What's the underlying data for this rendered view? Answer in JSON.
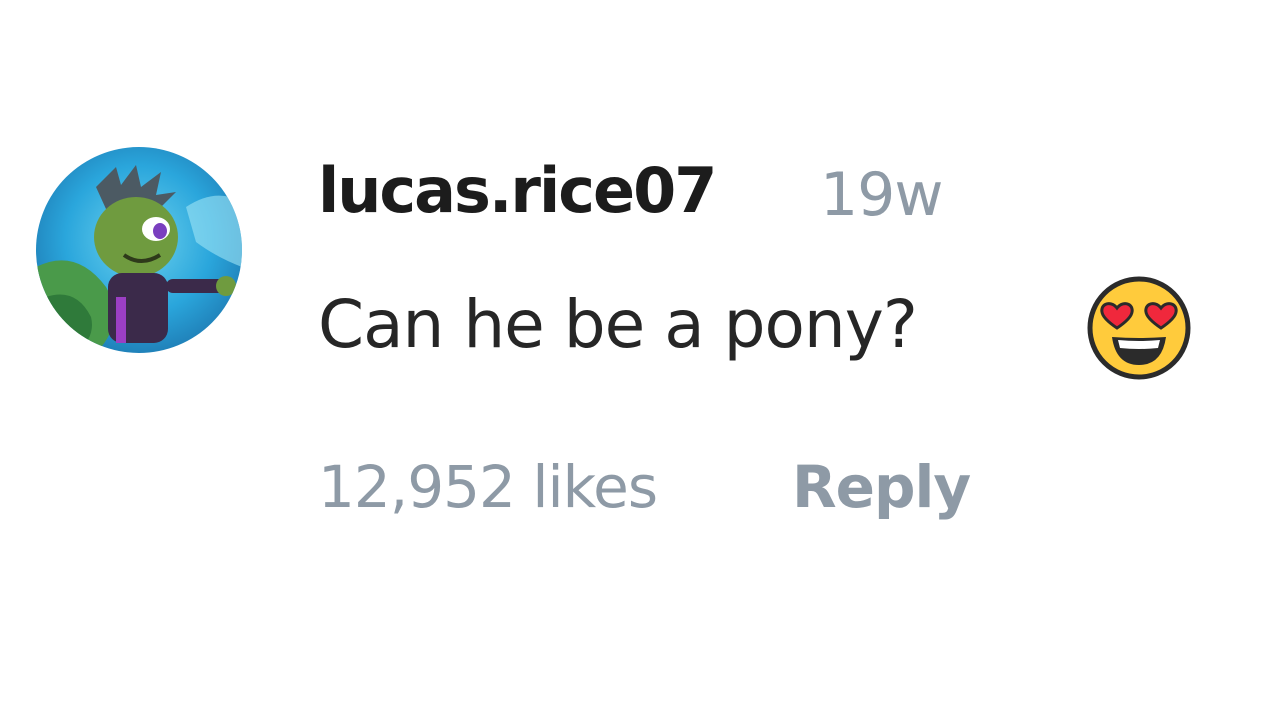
{
  "comment": {
    "username": "lucas.rice07",
    "timestamp": "19w",
    "text": "Can he be a pony?",
    "emoji_icon": "smiling-face-with-heart-eyes-icon",
    "likes_label": "12,952 likes",
    "reply_label": "Reply",
    "avatar_icon": "cartoon-character-avatar"
  },
  "colors": {
    "username": "#1c1c1c",
    "text": "#262626",
    "muted": "#8e9aa6",
    "background": "#ffffff"
  }
}
